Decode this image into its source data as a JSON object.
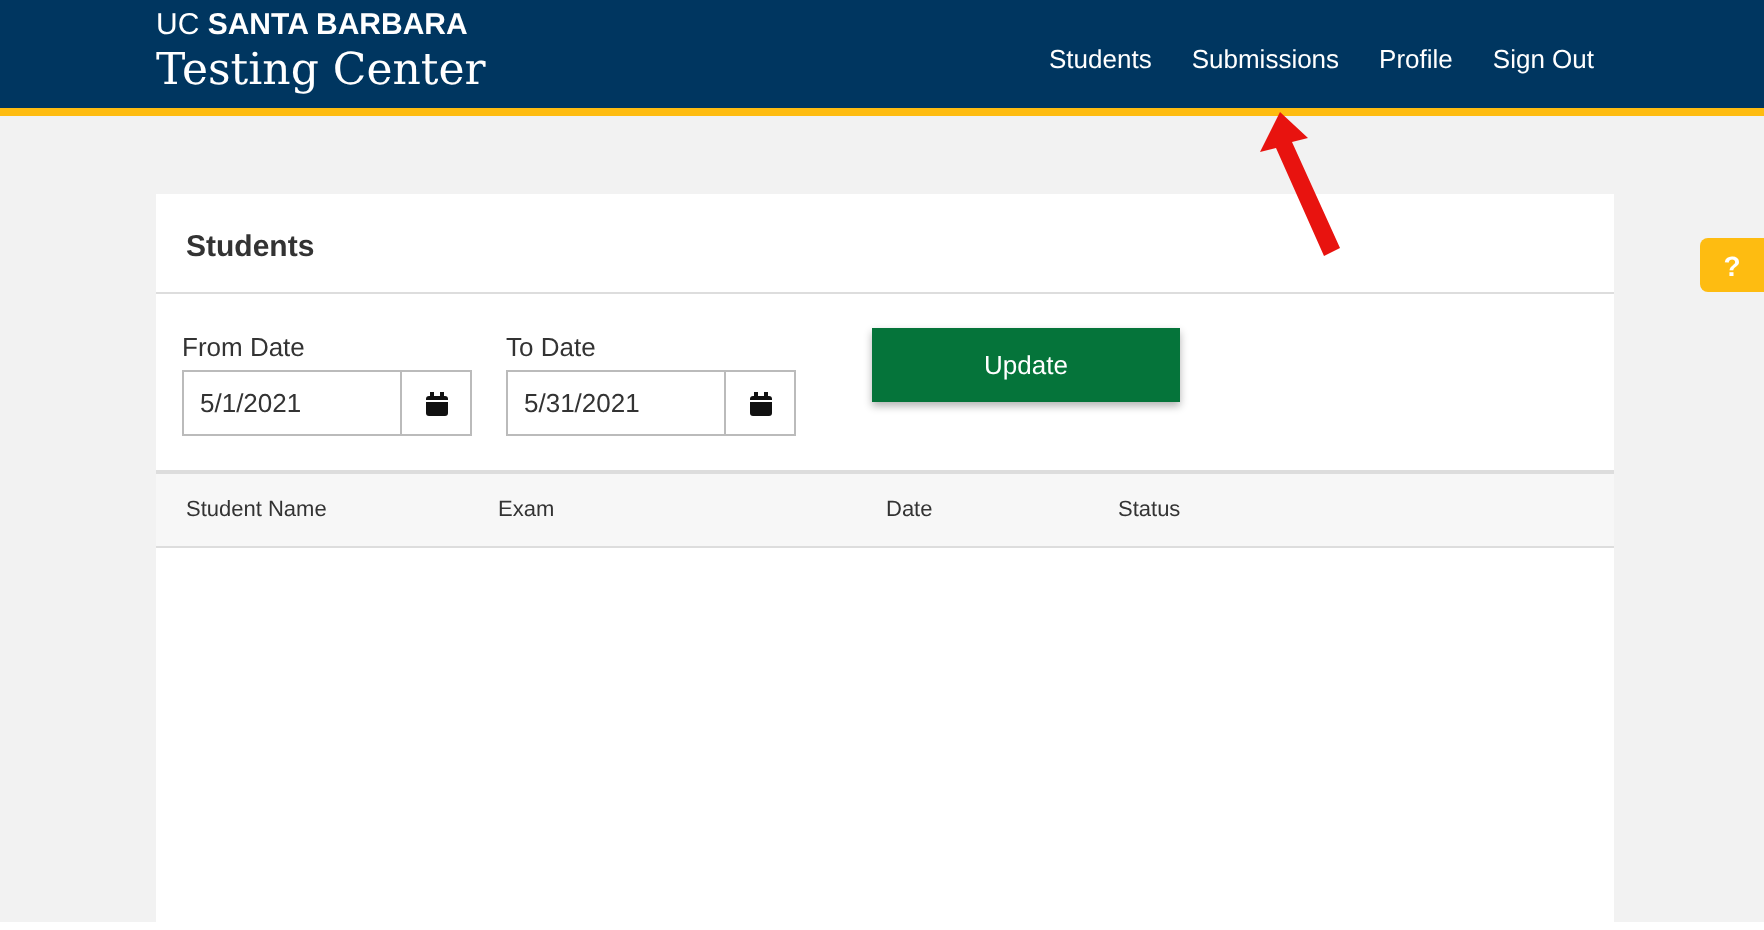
{
  "header": {
    "brand": "UC **SANTA BARBARA**",
    "title": "Testing Center",
    "nav": [
      {
        "label": "Students"
      },
      {
        "label": "Submissions"
      },
      {
        "label": "Profile"
      },
      {
        "label": "Sign Out"
      }
    ]
  },
  "card": {
    "title": "Students",
    "from": {
      "label": "From Date",
      "value": "5/1/2021"
    },
    "to": {
      "label": "To Date",
      "value": "5/31/2021"
    },
    "button": "Update",
    "columns": [
      "Student Name",
      "Exam",
      "Date",
      "Status"
    ]
  },
  "help": "?"
}
